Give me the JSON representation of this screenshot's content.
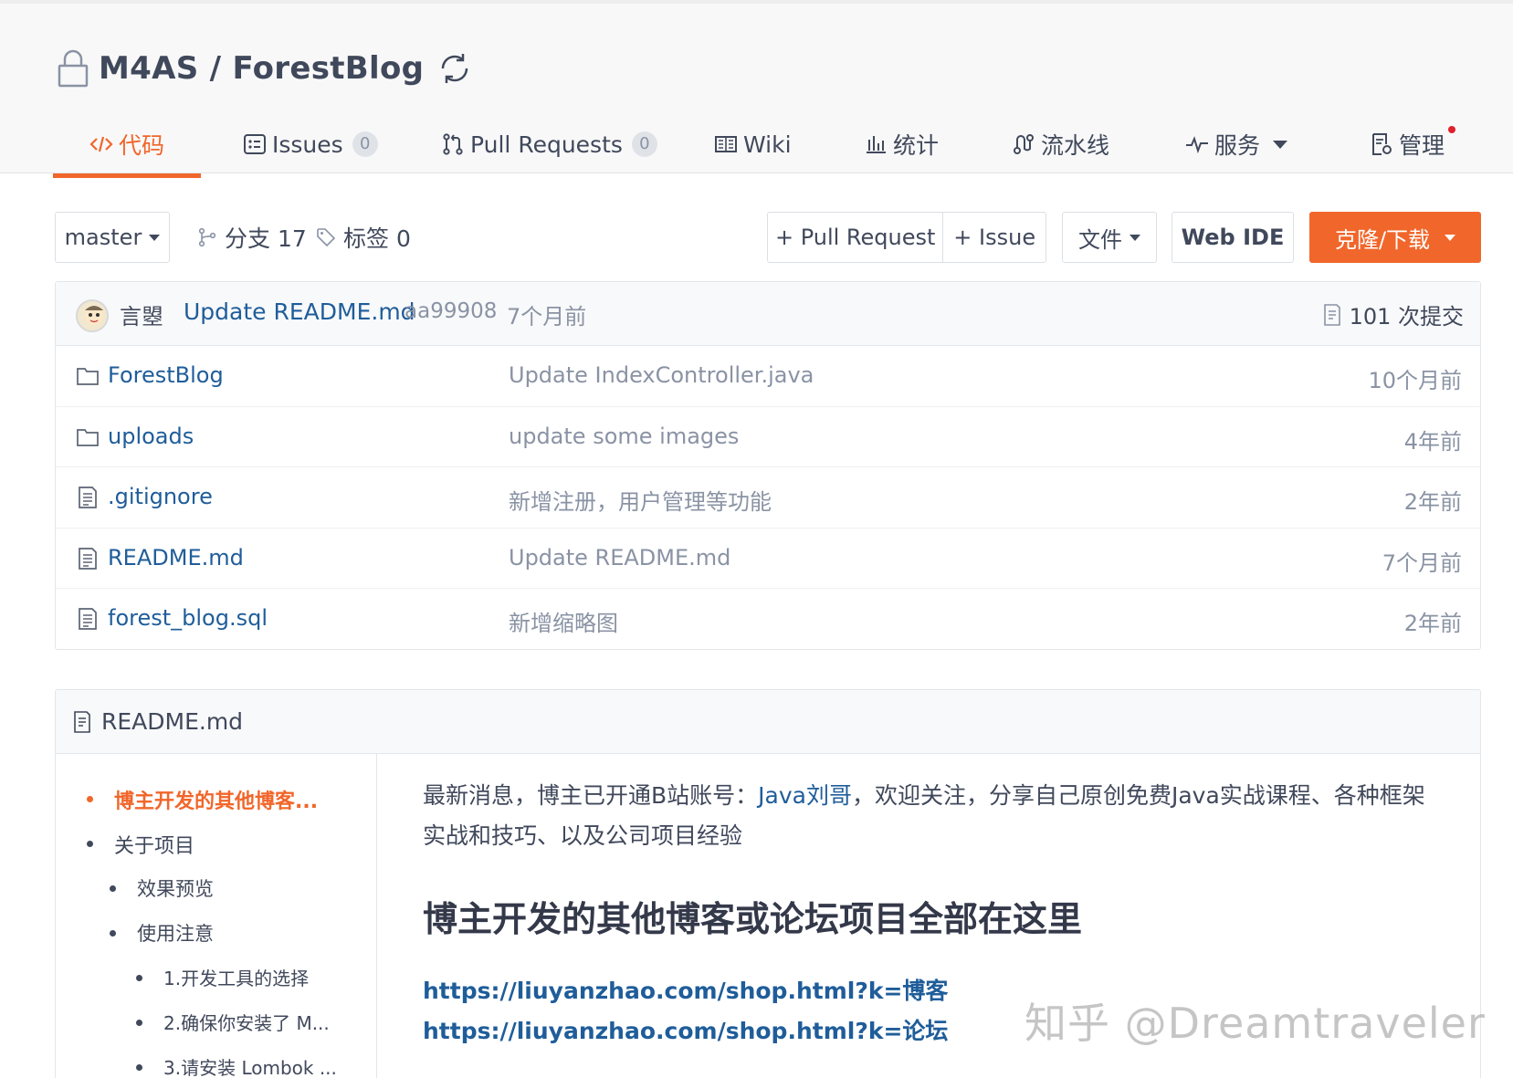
{
  "repo": {
    "title": "M4AS / ForestBlog"
  },
  "tabs": [
    {
      "label": "代码",
      "icon": "code-icon"
    },
    {
      "label": "Issues",
      "count": "0",
      "icon": "issue-icon"
    },
    {
      "label": "Pull Requests",
      "count": "0",
      "icon": "pull-request-icon"
    },
    {
      "label": "Wiki",
      "icon": "book-icon"
    },
    {
      "label": "统计",
      "icon": "bar-chart-icon"
    },
    {
      "label": "流水线",
      "icon": "pipeline-icon"
    },
    {
      "label": "服务",
      "icon": "pulse-icon"
    },
    {
      "label": "管理",
      "icon": "settings-doc-icon"
    }
  ],
  "toolbar": {
    "branch": "master",
    "branches": "分支 17",
    "tags": "标签 0",
    "new_pr": "+ Pull Request",
    "new_issue": "+ Issue",
    "file": "文件",
    "web_ide": "Web IDE",
    "clone": "克隆/下载"
  },
  "commit": {
    "author": "言曌",
    "message": "Update README.md",
    "sha": "aa99908",
    "time": "7个月前",
    "total": "101 次提交"
  },
  "files": [
    {
      "type": "folder",
      "name": "ForestBlog",
      "message": "Update IndexController.java",
      "time": "10个月前"
    },
    {
      "type": "folder",
      "name": "uploads",
      "message": "update some images",
      "time": "4年前"
    },
    {
      "type": "file",
      "name": ".gitignore",
      "message": "新增注册，用户管理等功能",
      "time": "2年前"
    },
    {
      "type": "file",
      "name": "README.md",
      "message": "Update README.md",
      "time": "7个月前"
    },
    {
      "type": "file",
      "name": "forest_blog.sql",
      "message": "新增缩略图",
      "time": "2年前"
    }
  ],
  "readme": {
    "filename": "README.md",
    "toc": [
      "博主开发的其他博客...",
      "关于项目",
      "效果预览",
      "使用注意",
      "1.开发工具的选择",
      "2.确保你安装了 M...",
      "3.请安装 Lombok ..."
    ],
    "intro_pre": "最新消息，博主已开通B站账号：",
    "intro_link": "Java刘哥",
    "intro_post": "，欢迎关注，分享自己原创免费Java实战课程、各种框架实战和技巧、以及公司项目经验",
    "heading": "博主开发的其他博客或论坛项目全部在这里",
    "links": [
      "https://liuyanzhao.com/shop.html?k=博客",
      "https://liuyanzhao.com/shop.html?k=论坛"
    ]
  },
  "watermark": "知乎 @Dreamtraveler",
  "colors": {
    "accent": "#f1662a",
    "link": "#1f5d9a",
    "muted": "#8a93a4"
  }
}
